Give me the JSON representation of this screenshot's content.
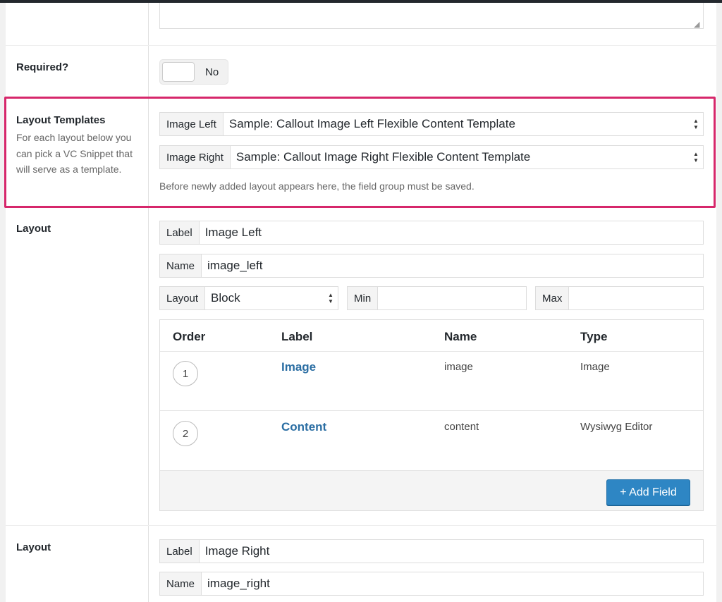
{
  "required": {
    "label": "Required?",
    "toggle_text": "No"
  },
  "layout_templates": {
    "label": "Layout Templates",
    "description": "For each layout below you can pick a VC Snippet that will serve as a template.",
    "rows": [
      {
        "prefix": "Image Left",
        "value": "Sample: Callout Image Left Flexible Content Template"
      },
      {
        "prefix": "Image Right",
        "value": "Sample: Callout Image Right Flexible Content Template"
      }
    ],
    "note": "Before newly added layout appears here, the field group must be saved."
  },
  "layout1": {
    "title": "Layout",
    "label_prefix": "Label",
    "label_value": "Image Left",
    "name_prefix": "Name",
    "name_value": "image_left",
    "layout_prefix": "Layout",
    "layout_value": "Block",
    "min_prefix": "Min",
    "min_value": "",
    "max_prefix": "Max",
    "max_value": "",
    "table": {
      "headers": [
        "Order",
        "Label",
        "Name",
        "Type"
      ],
      "rows": [
        {
          "order": "1",
          "label": "Image",
          "name": "image",
          "type": "Image"
        },
        {
          "order": "2",
          "label": "Content",
          "name": "content",
          "type": "Wysiwyg Editor"
        }
      ],
      "add_button": "+ Add Field"
    }
  },
  "layout2": {
    "title": "Layout",
    "label_prefix": "Label",
    "label_value": "Image Right",
    "name_prefix": "Name",
    "name_value": "image_right"
  },
  "icons": {
    "select_arrows": "up-down-arrows-icon",
    "resize": "resize-grip-icon"
  },
  "colors": {
    "highlight": "#d6276b",
    "link": "#2b6ea3",
    "button": "#2e86c4"
  }
}
